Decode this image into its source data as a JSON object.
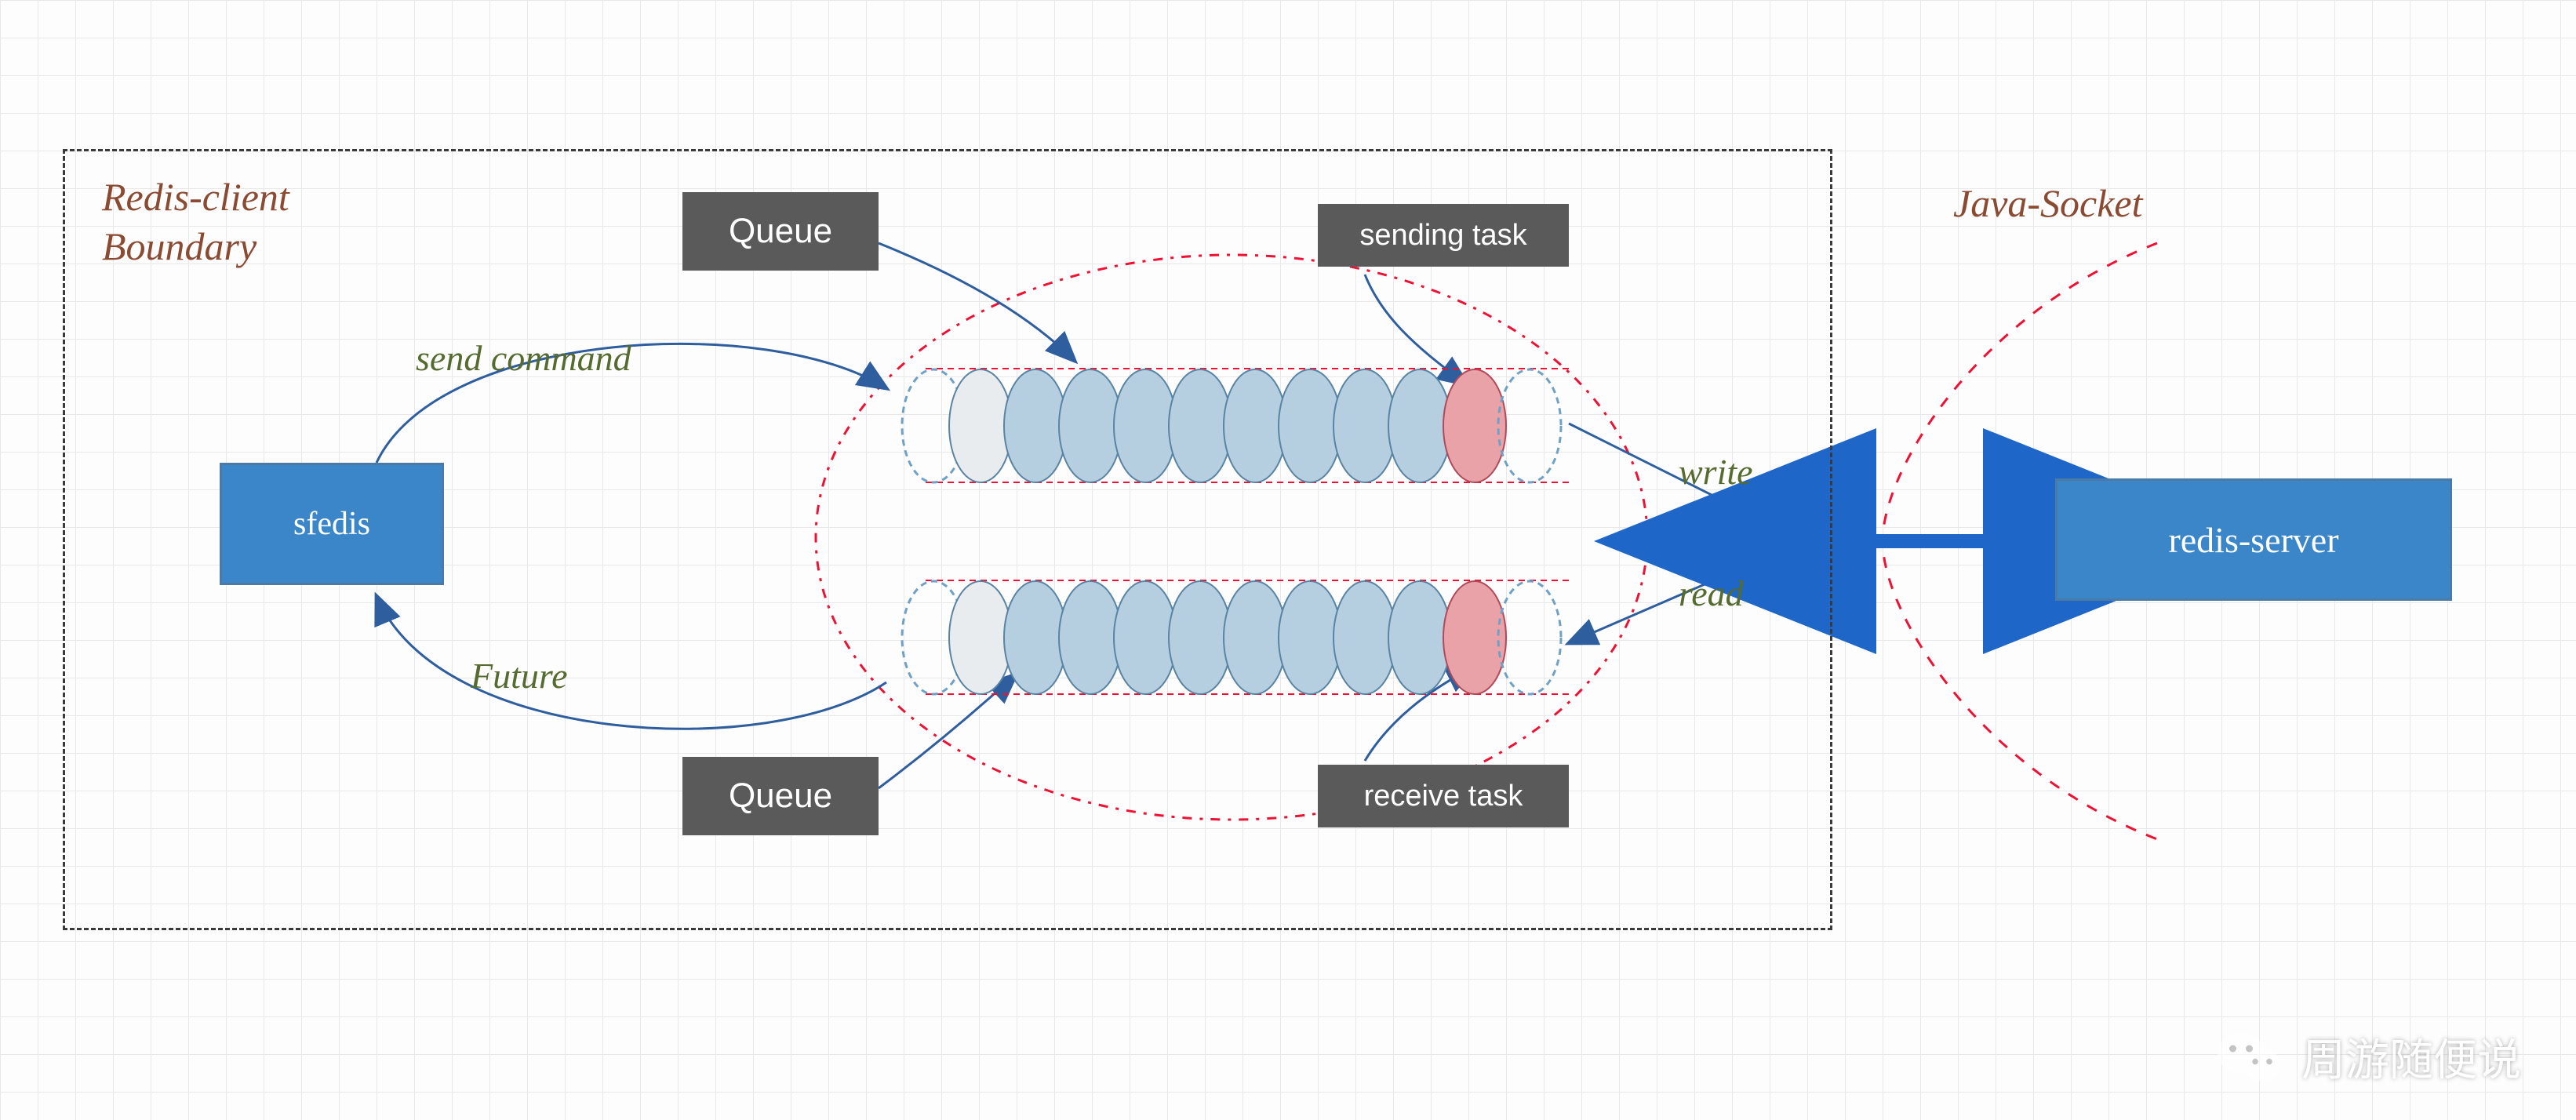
{
  "boundary_label_line1": "Redis-client",
  "boundary_label_line2": "Boundary",
  "sfedis_label": "sfedis",
  "redis_server_label": "redis-server",
  "queue_label_top": "Queue",
  "queue_label_bottom": "Queue",
  "sending_task_label": "sending task",
  "receive_task_label": "receive task",
  "send_command_label": "send command",
  "future_label": "Future",
  "write_label": "write",
  "read_label": "read",
  "java_socket_label": "Java-Socket",
  "watermark_text": "周游随便说"
}
